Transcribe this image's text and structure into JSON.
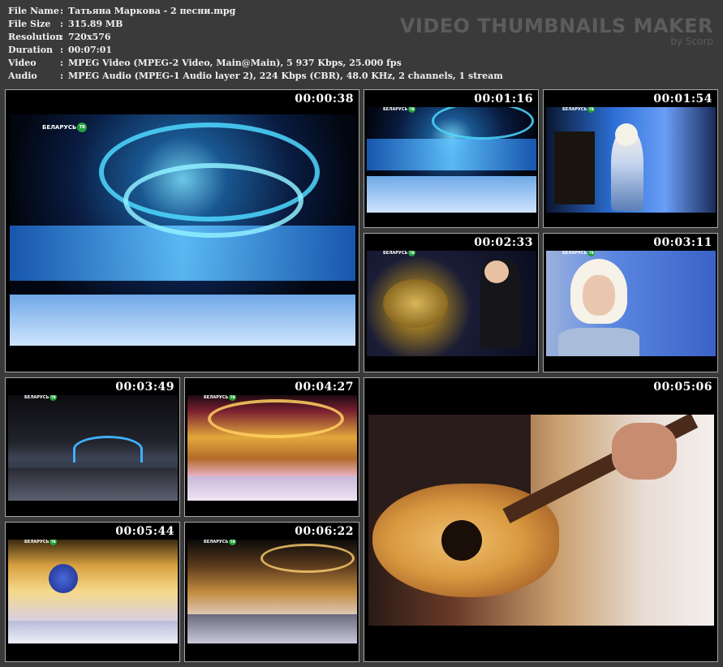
{
  "info": {
    "rows": [
      {
        "key": "File Name",
        "sep": ":",
        "value": "Татьяна Маркова - 2 песни.mpg"
      },
      {
        "key": "File Size",
        "sep": ":",
        "value": "315.89 MB"
      },
      {
        "key": "Resolution",
        "sep": ":",
        "value": "720x576"
      },
      {
        "key": "Duration",
        "sep": ":",
        "value": "00:07:01"
      },
      {
        "key": "Video",
        "sep": ":",
        "value": "MPEG Video (MPEG-2 Video, Main@Main), 5 937 Kbps, 25.000 fps"
      },
      {
        "key": "Audio",
        "sep": ":",
        "value": "MPEG Audio (MPEG-1 Audio layer 2), 224 Kbps (CBR), 48.0 KHz, 2 channels, 1 stream"
      }
    ]
  },
  "brand": {
    "title": "VIDEO THUMBNAILS MAKER",
    "subtitle": "by Scorp"
  },
  "channel_logo": {
    "name": "БЕЛАРУСЬ",
    "badge": "ТВ"
  },
  "thumbnails": [
    {
      "timestamp": "00:00:38",
      "scene": "stage-blue"
    },
    {
      "timestamp": "00:01:16",
      "scene": "stage-blue"
    },
    {
      "timestamp": "00:01:54",
      "scene": "singer-blue"
    },
    {
      "timestamp": "00:02:33",
      "scene": "drums"
    },
    {
      "timestamp": "00:03:11",
      "scene": "closeup"
    },
    {
      "timestamp": "00:03:49",
      "scene": "arena"
    },
    {
      "timestamp": "00:04:27",
      "scene": "gold"
    },
    {
      "timestamp": "00:05:06",
      "scene": "guitar"
    },
    {
      "timestamp": "00:05:44",
      "scene": "gold2"
    },
    {
      "timestamp": "00:06:22",
      "scene": "gold3"
    }
  ]
}
